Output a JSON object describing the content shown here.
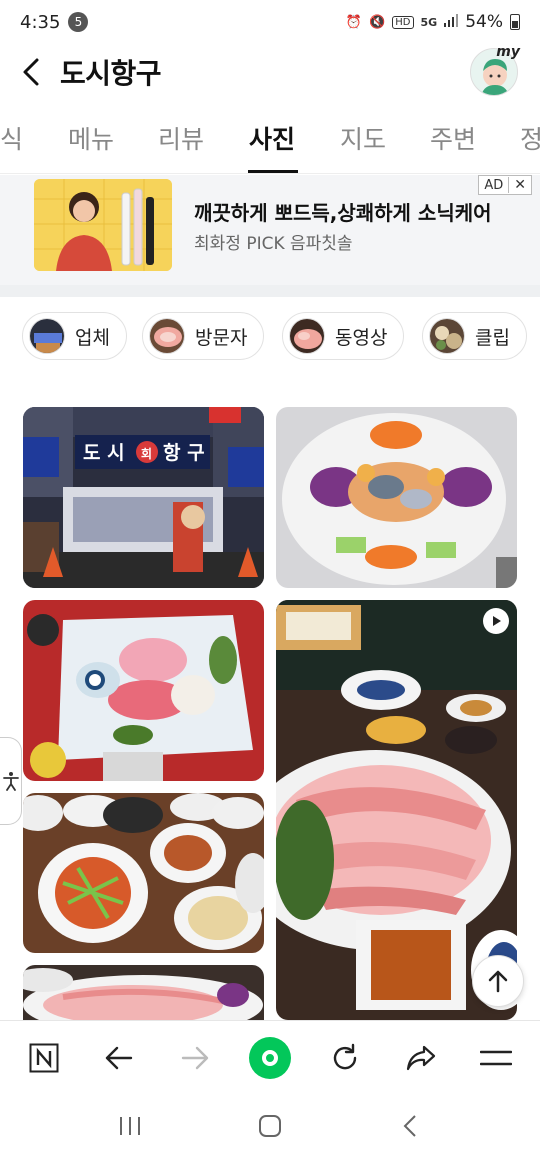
{
  "status_bar": {
    "time": "4:35",
    "notification_count": "5",
    "network": "5G",
    "hd": "HD",
    "battery": "54%"
  },
  "header": {
    "title": "도시항구",
    "avatar_label": "my"
  },
  "tabs": [
    {
      "label": "식"
    },
    {
      "label": "메뉴"
    },
    {
      "label": "리뷰"
    },
    {
      "label": "사진"
    },
    {
      "label": "지도"
    },
    {
      "label": "주변"
    },
    {
      "label": "정"
    }
  ],
  "active_tab": "사진",
  "ad": {
    "title": "깨끗하게 뽀드득,상쾌하게 소닉케어",
    "subtitle": "최화정 PICK 음파칫솔",
    "badge": "AD",
    "close": "✕"
  },
  "chips": [
    {
      "label": "업체"
    },
    {
      "label": "방문자"
    },
    {
      "label": "동영상"
    },
    {
      "label": "클립"
    }
  ],
  "photos": [
    {
      "desc": "storefront",
      "sign": "도시 회 항구"
    },
    {
      "desc": "sea-urchin-platter"
    },
    {
      "desc": "sashimi-platter"
    },
    {
      "desc": "sliced-fish-video",
      "is_video": true
    },
    {
      "desc": "side-dishes"
    },
    {
      "desc": "sashimi-closeup"
    }
  ],
  "colors": {
    "brand_green": "#03c75a",
    "tab_active": "#111111",
    "tab_inactive": "#888888",
    "ad_bg": "#f4f5f7"
  }
}
